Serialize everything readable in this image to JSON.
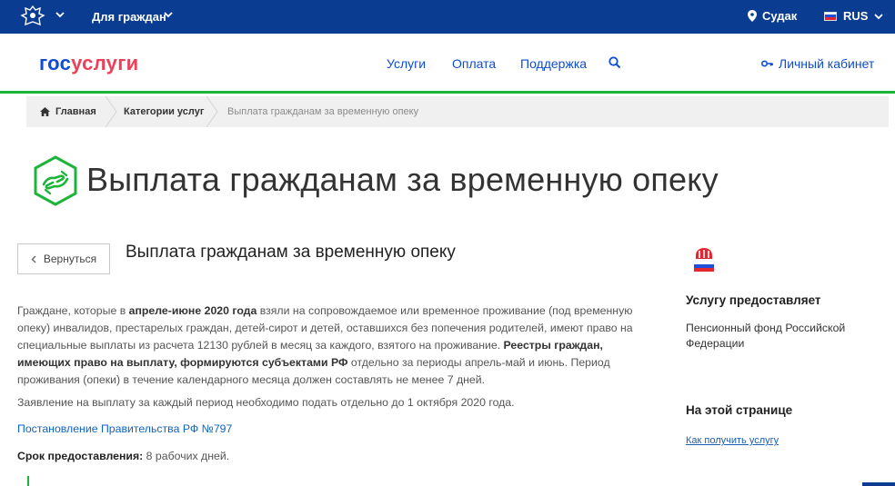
{
  "topbar": {
    "for_citizens": "Для граждан",
    "location": "Судак",
    "language": "RUS",
    "colors": {
      "background": "#0a3d91"
    },
    "icons": [
      "emblem-icon",
      "chevron-down-icon",
      "location-pin-icon",
      "flag-icon"
    ]
  },
  "header": {
    "logo_gos": "гос",
    "logo_uslugi": "услуги",
    "nav": [
      "Услуги",
      "Оплата",
      "Поддержка"
    ],
    "cabinet": "Личный кабинет",
    "colors": {
      "link": "#0d4cd3",
      "accent_line": "#1cb53a"
    }
  },
  "breadcrumbs": {
    "home": "Главная",
    "categories": "Категории услуг",
    "current": "Выплата гражданам за временную опеку"
  },
  "page": {
    "title": "Выплата гражданам за временную опеку",
    "back": "Вернуться",
    "subtitle": "Выплата гражданам за временную опеку",
    "p1_a": "Граждане, которые в ",
    "p1_b": "апреле-июне 2020 года",
    "p1_c": " взяли на сопровождаемое или временное проживание (под временную опеку) инвалидов, престарелых граждан, детей-сирот и детей, оставшихся без попечения родителей, имеют право на специальные выплаты из расчета 12130 рублей в месяц за каждого, взятого на проживание. ",
    "p1_d": "Реестры граждан, имеющих право на выплату, формируются субъектами РФ",
    "p1_e": " отдельно за периоды апрель-май и июнь. Период проживания (опеки) в течение календарного месяца должен составлять не менее 7 дней.",
    "p2": "Заявление на выплату за каждый период необходимо подать отдельно до 1 октября 2020 года.",
    "link": "Постановление Правительства РФ №797",
    "term_label": "Срок предоставления:",
    "term_value": " 8 рабочих дней."
  },
  "sidebar": {
    "provider_heading": "Услугу предоставляет",
    "provider": "Пенсионный фонд Российской Федерации",
    "on_page_heading": "На этой странице",
    "anchor": "Как получить услугу"
  }
}
